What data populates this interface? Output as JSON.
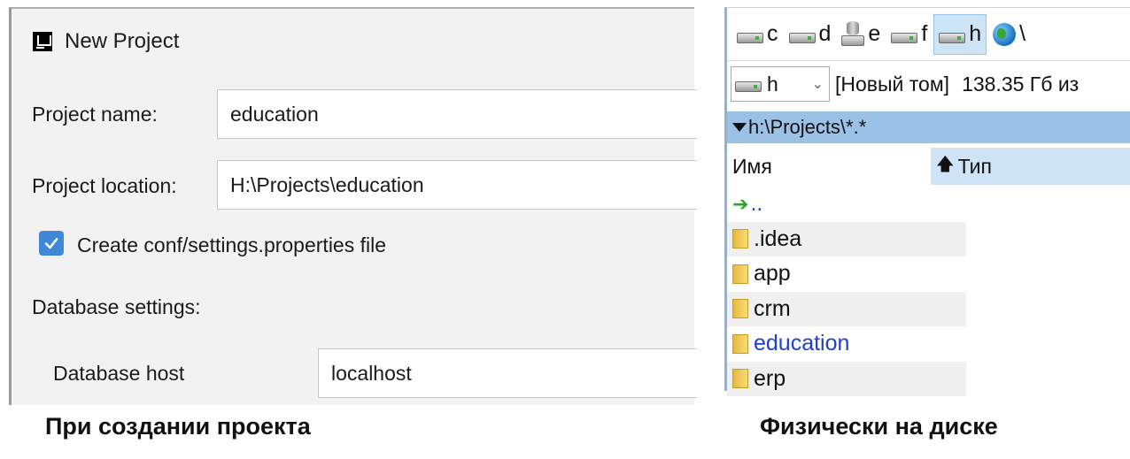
{
  "dialog": {
    "title": "New Project",
    "project_name_label": "Project name:",
    "project_name_value": "education",
    "project_location_label": "Project location:",
    "project_location_value": "H:\\Projects\\education",
    "create_conf_label": "Create conf/settings.properties file",
    "create_conf_checked": true,
    "database_settings_label": "Database settings:",
    "database_host_label": "Database host",
    "database_host_value": "localhost"
  },
  "file_manager": {
    "drives": [
      {
        "letter": "c",
        "icon": "hdd-icon"
      },
      {
        "letter": "d",
        "icon": "hdd-icon"
      },
      {
        "letter": "e",
        "icon": "network-drive-icon"
      },
      {
        "letter": "f",
        "icon": "hdd-icon"
      },
      {
        "letter": "h",
        "icon": "hdd-icon",
        "active": true
      },
      {
        "letter": "\\",
        "icon": "globe-icon"
      }
    ],
    "current_drive": "h",
    "volume_label": "[Новый том]",
    "free_space": "138.35 Гб из",
    "current_path": "h:\\Projects\\*.*",
    "col_name": "Имя",
    "col_type": "Тип",
    "items": [
      {
        "name": "..",
        "kind": "up"
      },
      {
        "name": ".idea",
        "kind": "folder"
      },
      {
        "name": "app",
        "kind": "folder"
      },
      {
        "name": "crm",
        "kind": "folder"
      },
      {
        "name": "education",
        "kind": "folder",
        "selected": true
      },
      {
        "name": "erp",
        "kind": "folder"
      }
    ]
  },
  "captions": {
    "left": "При создании проекта",
    "right": "Физически на диске"
  },
  "colors": {
    "checkbox": "#3f88d8",
    "path_bar": "#9cc1e6",
    "selected_text": "#2040d0"
  }
}
